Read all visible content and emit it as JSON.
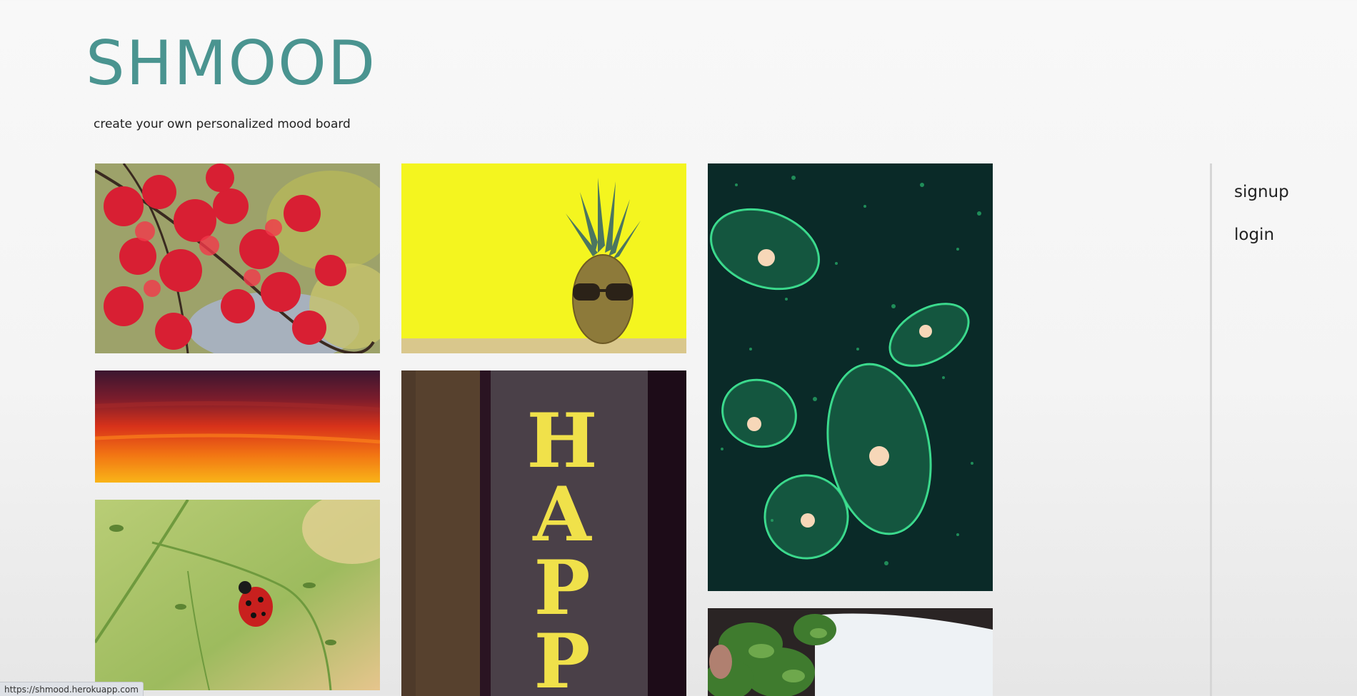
{
  "app": {
    "title": "SHMOOD",
    "tagline": "create your own personalized mood board"
  },
  "nav": {
    "signup_label": "signup",
    "login_label": "login"
  },
  "board": {
    "tiles": [
      {
        "name": "red-maple-leaves-photo",
        "alt": "red maple leaves"
      },
      {
        "name": "pineapple-sunglasses-photo",
        "alt": "pineapple with sunglasses"
      },
      {
        "name": "green-jellyfish-photo",
        "alt": "green jellyfish"
      },
      {
        "name": "sunset-sky-photo",
        "alt": "sunset sky"
      },
      {
        "name": "happy-sign-photo",
        "alt": "happy sign"
      },
      {
        "name": "ladybug-grass-photo",
        "alt": "ladybug on grass"
      },
      {
        "name": "green-herbs-photo",
        "alt": "green herbs"
      }
    ]
  },
  "status_bar": {
    "url": "https://shmood.herokuapp.com"
  },
  "colors": {
    "brand": "#4a9490",
    "text": "#222222",
    "divider": "#d6d6d6"
  }
}
